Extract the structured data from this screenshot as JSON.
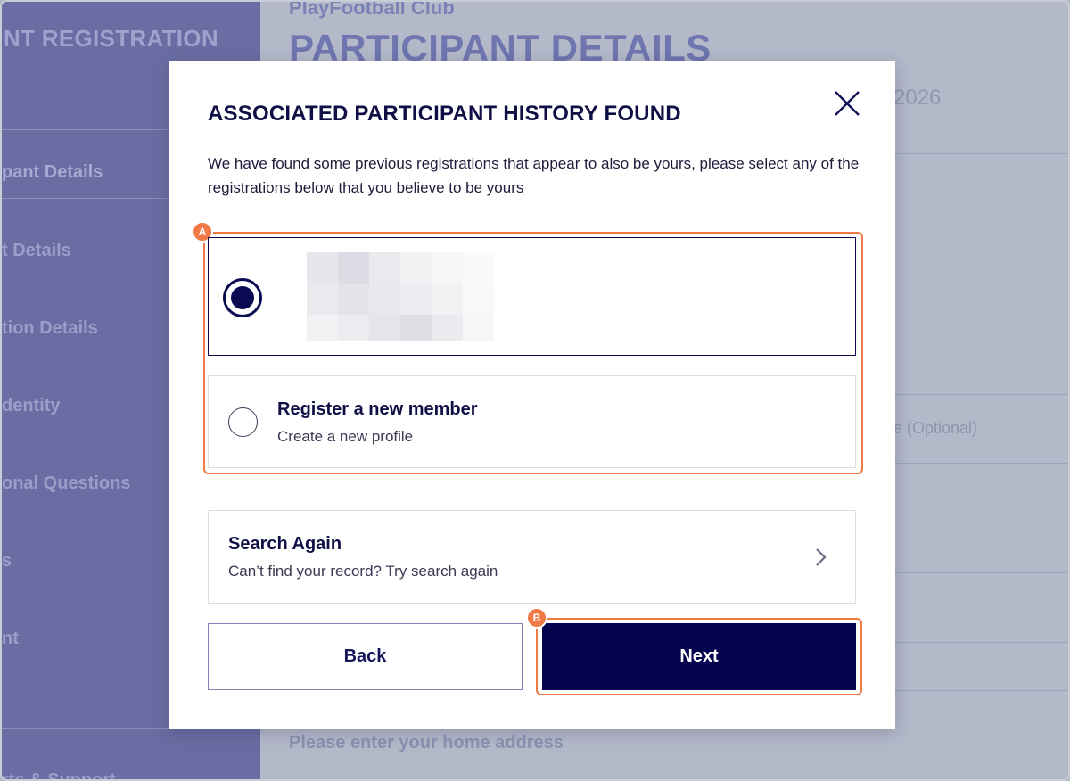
{
  "background": {
    "sidebar": {
      "brand": "NT REGISTRATION",
      "nav_items": [
        "pant Details",
        "t Details",
        "tion Details",
        "dentity",
        "onal Questions",
        "s",
        "nt",
        "rts & Support"
      ]
    },
    "main": {
      "club_name": "PlayFootball Club",
      "page_title": "PARTICIPANT DETAILS",
      "season_year": "2026",
      "optional_label": "e (Optional)",
      "address_prompt": "Please enter your home address"
    }
  },
  "modal": {
    "title": "ASSOCIATED PARTICIPANT HISTORY FOUND",
    "description": "We have found some previous registrations that appear to also be yours, please select any of the registrations below that you believe to be yours",
    "options": [
      {
        "title": "",
        "subtitle": "",
        "selected": true,
        "redacted": true
      },
      {
        "title": "Register a new member",
        "subtitle": "Create a new profile",
        "selected": false
      }
    ],
    "search_again": {
      "title": "Search Again",
      "subtitle": "Can’t find your record? Try search again"
    },
    "back_label": "Back",
    "next_label": "Next"
  },
  "annotations": {
    "a": "A",
    "b": "B"
  },
  "colors": {
    "primary": "#04044f",
    "annotation": "#f07a45",
    "sidebar": "#696da3",
    "overlay_bg": "#b3b9c9"
  }
}
